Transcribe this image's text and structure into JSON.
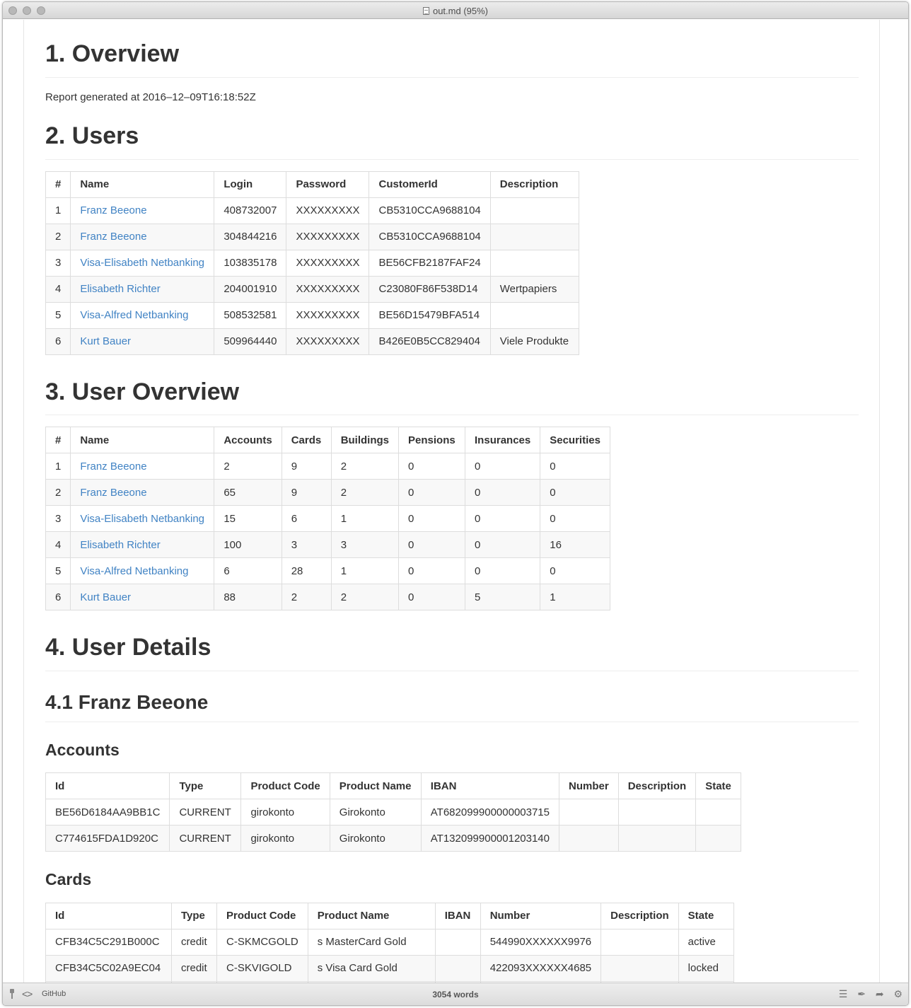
{
  "window": {
    "title": "out.md (95%)"
  },
  "overview": {
    "heading": "1. Overview",
    "report_text": "Report generated at 2016–12–09T16:18:52Z"
  },
  "users": {
    "heading": "2. Users",
    "columns": [
      "#",
      "Name",
      "Login",
      "Password",
      "CustomerId",
      "Description"
    ],
    "rows": [
      {
        "num": "1",
        "name": "Franz Beeone",
        "login": "408732007",
        "password": "XXXXXXXXX",
        "customer_id": "CB5310CCA9688104",
        "description": ""
      },
      {
        "num": "2",
        "name": "Franz Beeone",
        "login": "304844216",
        "password": "XXXXXXXXX",
        "customer_id": "CB5310CCA9688104",
        "description": ""
      },
      {
        "num": "3",
        "name": "Visa-Elisabeth Netbanking",
        "login": "103835178",
        "password": "XXXXXXXXX",
        "customer_id": "BE56CFB2187FAF24",
        "description": ""
      },
      {
        "num": "4",
        "name": "Elisabeth Richter",
        "login": "204001910",
        "password": "XXXXXXXXX",
        "customer_id": "C23080F86F538D14",
        "description": "Wertpapiers"
      },
      {
        "num": "5",
        "name": "Visa-Alfred Netbanking",
        "login": "508532581",
        "password": "XXXXXXXXX",
        "customer_id": "BE56D15479BFA514",
        "description": ""
      },
      {
        "num": "6",
        "name": "Kurt Bauer",
        "login": "509964440",
        "password": "XXXXXXXXX",
        "customer_id": "B426E0B5CC829404",
        "description": "Viele Produkte"
      }
    ]
  },
  "user_overview": {
    "heading": "3. User Overview",
    "columns": [
      "#",
      "Name",
      "Accounts",
      "Cards",
      "Buildings",
      "Pensions",
      "Insurances",
      "Securities"
    ],
    "rows": [
      {
        "num": "1",
        "name": "Franz Beeone",
        "accounts": "2",
        "cards": "9",
        "buildings": "2",
        "pensions": "0",
        "insurances": "0",
        "securities": "0"
      },
      {
        "num": "2",
        "name": "Franz Beeone",
        "accounts": "65",
        "cards": "9",
        "buildings": "2",
        "pensions": "0",
        "insurances": "0",
        "securities": "0"
      },
      {
        "num": "3",
        "name": "Visa-Elisabeth Netbanking",
        "accounts": "15",
        "cards": "6",
        "buildings": "1",
        "pensions": "0",
        "insurances": "0",
        "securities": "0"
      },
      {
        "num": "4",
        "name": "Elisabeth Richter",
        "accounts": "100",
        "cards": "3",
        "buildings": "3",
        "pensions": "0",
        "insurances": "0",
        "securities": "16"
      },
      {
        "num": "5",
        "name": "Visa-Alfred Netbanking",
        "accounts": "6",
        "cards": "28",
        "buildings": "1",
        "pensions": "0",
        "insurances": "0",
        "securities": "0"
      },
      {
        "num": "6",
        "name": "Kurt Bauer",
        "accounts": "88",
        "cards": "2",
        "buildings": "2",
        "pensions": "0",
        "insurances": "5",
        "securities": "1"
      }
    ]
  },
  "user_details": {
    "heading": "4. User Details",
    "sub_heading": "4.1 Franz Beeone",
    "accounts": {
      "heading": "Accounts",
      "columns": [
        "Id",
        "Type",
        "Product Code",
        "Product Name",
        "IBAN",
        "Number",
        "Description",
        "State"
      ],
      "rows": [
        {
          "id": "BE56D6184AA9BB1C",
          "type": "CURRENT",
          "product_code": "girokonto",
          "product_name": "Girokonto",
          "iban": "AT682099900000003715",
          "number": "",
          "description": "",
          "state": ""
        },
        {
          "id": "C774615FDA1D920C",
          "type": "CURRENT",
          "product_code": "girokonto",
          "product_name": "Girokonto",
          "iban": "AT132099900001203140",
          "number": "",
          "description": "",
          "state": ""
        }
      ]
    },
    "cards": {
      "heading": "Cards",
      "columns": [
        "Id",
        "Type",
        "Product Code",
        "Product Name",
        "IBAN",
        "Number",
        "Description",
        "State"
      ],
      "rows": [
        {
          "id": "CFB34C5C291B000C",
          "type": "credit",
          "product_code": "C-SKMCGOLD",
          "product_name": "s MasterCard Gold",
          "iban": "",
          "number": "544990XXXXXX9976",
          "description": "",
          "state": "active"
        },
        {
          "id": "CFB34C5C02A9EC04",
          "type": "credit",
          "product_code": "C-SKVIGOLD",
          "product_name": "s Visa Card Gold",
          "iban": "",
          "number": "422093XXXXXX4685",
          "description": "",
          "state": "locked"
        },
        {
          "id": "",
          "type": "",
          "product_code": "",
          "product_name": "",
          "iban": "",
          "number": "",
          "description": "",
          "state": ""
        }
      ]
    }
  },
  "statusbar": {
    "mode": "GitHub",
    "word_count": "3054 words",
    "icons": [
      "pin-icon",
      "code-icon",
      "list-icon",
      "feather-icon",
      "share-icon",
      "gear-icon"
    ]
  }
}
